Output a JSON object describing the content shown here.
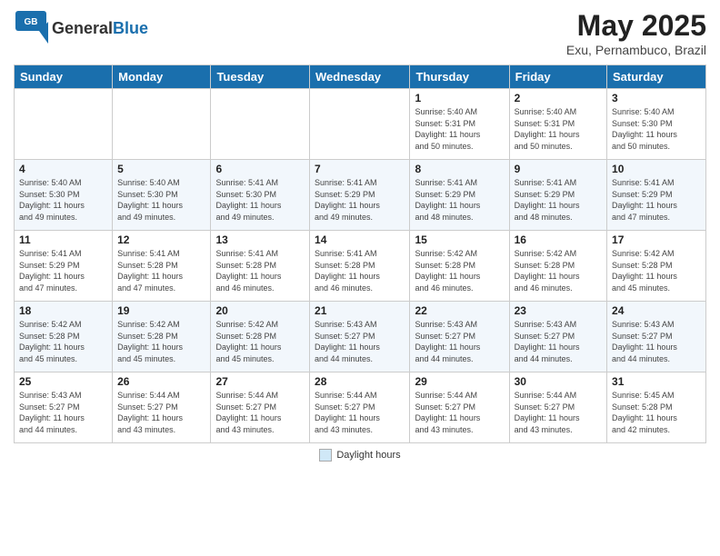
{
  "header": {
    "logo_general": "General",
    "logo_blue": "Blue",
    "title": "May 2025",
    "subtitle": "Exu, Pernambuco, Brazil"
  },
  "days_of_week": [
    "Sunday",
    "Monday",
    "Tuesday",
    "Wednesday",
    "Thursday",
    "Friday",
    "Saturday"
  ],
  "weeks": [
    [
      {
        "day": "",
        "info": ""
      },
      {
        "day": "",
        "info": ""
      },
      {
        "day": "",
        "info": ""
      },
      {
        "day": "",
        "info": ""
      },
      {
        "day": "1",
        "info": "Sunrise: 5:40 AM\nSunset: 5:31 PM\nDaylight: 11 hours\nand 50 minutes."
      },
      {
        "day": "2",
        "info": "Sunrise: 5:40 AM\nSunset: 5:31 PM\nDaylight: 11 hours\nand 50 minutes."
      },
      {
        "day": "3",
        "info": "Sunrise: 5:40 AM\nSunset: 5:30 PM\nDaylight: 11 hours\nand 50 minutes."
      }
    ],
    [
      {
        "day": "4",
        "info": "Sunrise: 5:40 AM\nSunset: 5:30 PM\nDaylight: 11 hours\nand 49 minutes."
      },
      {
        "day": "5",
        "info": "Sunrise: 5:40 AM\nSunset: 5:30 PM\nDaylight: 11 hours\nand 49 minutes."
      },
      {
        "day": "6",
        "info": "Sunrise: 5:41 AM\nSunset: 5:30 PM\nDaylight: 11 hours\nand 49 minutes."
      },
      {
        "day": "7",
        "info": "Sunrise: 5:41 AM\nSunset: 5:29 PM\nDaylight: 11 hours\nand 49 minutes."
      },
      {
        "day": "8",
        "info": "Sunrise: 5:41 AM\nSunset: 5:29 PM\nDaylight: 11 hours\nand 48 minutes."
      },
      {
        "day": "9",
        "info": "Sunrise: 5:41 AM\nSunset: 5:29 PM\nDaylight: 11 hours\nand 48 minutes."
      },
      {
        "day": "10",
        "info": "Sunrise: 5:41 AM\nSunset: 5:29 PM\nDaylight: 11 hours\nand 47 minutes."
      }
    ],
    [
      {
        "day": "11",
        "info": "Sunrise: 5:41 AM\nSunset: 5:29 PM\nDaylight: 11 hours\nand 47 minutes."
      },
      {
        "day": "12",
        "info": "Sunrise: 5:41 AM\nSunset: 5:28 PM\nDaylight: 11 hours\nand 47 minutes."
      },
      {
        "day": "13",
        "info": "Sunrise: 5:41 AM\nSunset: 5:28 PM\nDaylight: 11 hours\nand 46 minutes."
      },
      {
        "day": "14",
        "info": "Sunrise: 5:41 AM\nSunset: 5:28 PM\nDaylight: 11 hours\nand 46 minutes."
      },
      {
        "day": "15",
        "info": "Sunrise: 5:42 AM\nSunset: 5:28 PM\nDaylight: 11 hours\nand 46 minutes."
      },
      {
        "day": "16",
        "info": "Sunrise: 5:42 AM\nSunset: 5:28 PM\nDaylight: 11 hours\nand 46 minutes."
      },
      {
        "day": "17",
        "info": "Sunrise: 5:42 AM\nSunset: 5:28 PM\nDaylight: 11 hours\nand 45 minutes."
      }
    ],
    [
      {
        "day": "18",
        "info": "Sunrise: 5:42 AM\nSunset: 5:28 PM\nDaylight: 11 hours\nand 45 minutes."
      },
      {
        "day": "19",
        "info": "Sunrise: 5:42 AM\nSunset: 5:28 PM\nDaylight: 11 hours\nand 45 minutes."
      },
      {
        "day": "20",
        "info": "Sunrise: 5:42 AM\nSunset: 5:28 PM\nDaylight: 11 hours\nand 45 minutes."
      },
      {
        "day": "21",
        "info": "Sunrise: 5:43 AM\nSunset: 5:27 PM\nDaylight: 11 hours\nand 44 minutes."
      },
      {
        "day": "22",
        "info": "Sunrise: 5:43 AM\nSunset: 5:27 PM\nDaylight: 11 hours\nand 44 minutes."
      },
      {
        "day": "23",
        "info": "Sunrise: 5:43 AM\nSunset: 5:27 PM\nDaylight: 11 hours\nand 44 minutes."
      },
      {
        "day": "24",
        "info": "Sunrise: 5:43 AM\nSunset: 5:27 PM\nDaylight: 11 hours\nand 44 minutes."
      }
    ],
    [
      {
        "day": "25",
        "info": "Sunrise: 5:43 AM\nSunset: 5:27 PM\nDaylight: 11 hours\nand 44 minutes."
      },
      {
        "day": "26",
        "info": "Sunrise: 5:44 AM\nSunset: 5:27 PM\nDaylight: 11 hours\nand 43 minutes."
      },
      {
        "day": "27",
        "info": "Sunrise: 5:44 AM\nSunset: 5:27 PM\nDaylight: 11 hours\nand 43 minutes."
      },
      {
        "day": "28",
        "info": "Sunrise: 5:44 AM\nSunset: 5:27 PM\nDaylight: 11 hours\nand 43 minutes."
      },
      {
        "day": "29",
        "info": "Sunrise: 5:44 AM\nSunset: 5:27 PM\nDaylight: 11 hours\nand 43 minutes."
      },
      {
        "day": "30",
        "info": "Sunrise: 5:44 AM\nSunset: 5:27 PM\nDaylight: 11 hours\nand 43 minutes."
      },
      {
        "day": "31",
        "info": "Sunrise: 5:45 AM\nSunset: 5:28 PM\nDaylight: 11 hours\nand 42 minutes."
      }
    ]
  ],
  "footer": {
    "legend_label": "Daylight hours"
  }
}
